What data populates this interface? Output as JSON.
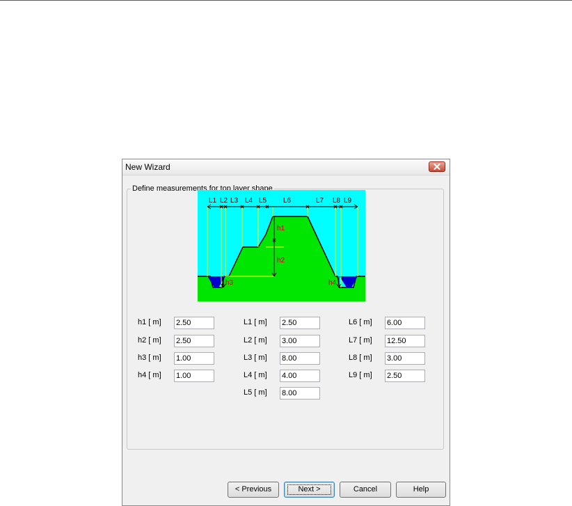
{
  "window": {
    "title": "New Wizard"
  },
  "group": {
    "legend": "Define measurements for top layer shape"
  },
  "diagram": {
    "top_labels": [
      "L1",
      "L2",
      "L3",
      "L4",
      "L5",
      "L6",
      "L7",
      "L8",
      "L9"
    ],
    "height_labels": [
      "h1",
      "h2",
      "h3",
      "h4"
    ],
    "colors": {
      "sky": "#00ffff",
      "ground": "#00e600",
      "water": "#0000cc",
      "dim": "#ffff00",
      "label": "#cc0000"
    }
  },
  "fields": {
    "h1": {
      "label": "h1   [ m]",
      "value": "2.50"
    },
    "h2": {
      "label": "h2   [ m]",
      "value": "2.50"
    },
    "h3": {
      "label": "h3   [ m]",
      "value": "1.00"
    },
    "h4": {
      "label": "h4   [ m]",
      "value": "1.00"
    },
    "L1": {
      "label": "L1   [ m]",
      "value": "2.50"
    },
    "L2": {
      "label": "L2   [ m]",
      "value": "3.00"
    },
    "L3": {
      "label": "L3   [ m]",
      "value": "8.00"
    },
    "L4": {
      "label": "L4   [ m]",
      "value": "4.00"
    },
    "L5": {
      "label": "L5   [ m]",
      "value": "8.00"
    },
    "L6": {
      "label": "L6   [ m]",
      "value": "6.00"
    },
    "L7": {
      "label": "L7   [ m]",
      "value": "12.50"
    },
    "L8": {
      "label": "L8   [ m]",
      "value": "3.00"
    },
    "L9": {
      "label": "L9   [ m]",
      "value": "2.50"
    }
  },
  "buttons": {
    "previous": "< Previous",
    "next": "Next >",
    "cancel": "Cancel",
    "help": "Help"
  }
}
